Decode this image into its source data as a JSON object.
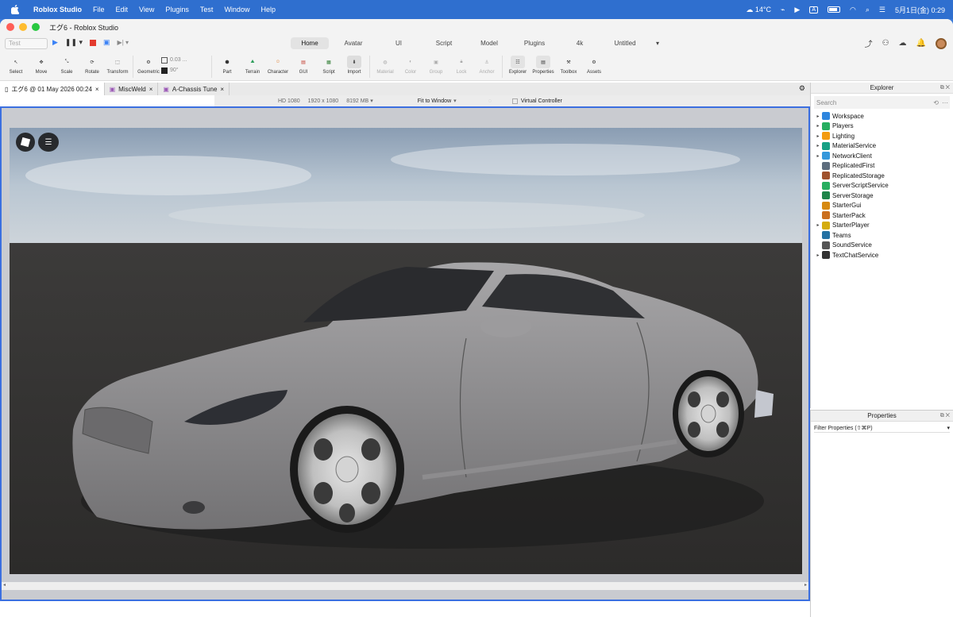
{
  "menubar": {
    "app_name": "Roblox Studio",
    "items": [
      "File",
      "Edit",
      "View",
      "Plugins",
      "Test",
      "Window",
      "Help"
    ],
    "weather": "14°C",
    "clock": "5月1日(金) 0:29",
    "input_indicator": "A"
  },
  "window": {
    "title": "エグ6 - Roblox Studio"
  },
  "tabsrow": {
    "test_placeholder": "Test",
    "ribbon_tabs": [
      "Home",
      "Avatar",
      "UI",
      "Script",
      "Model",
      "Plugins",
      "4k",
      "Untitled"
    ],
    "active_tab": "Home"
  },
  "toolbar": {
    "tools": [
      "Select",
      "Move",
      "Scale",
      "Rotate",
      "Transform",
      "Geometric"
    ],
    "snap_move": "0.03 ...",
    "snap_rotate": "90°",
    "insert_tools": [
      "Part",
      "Terrain",
      "Character",
      "GUI",
      "Script",
      "Import"
    ],
    "dim_tools": [
      "Material",
      "Color",
      "Group",
      "Lock",
      "Anchor"
    ],
    "panel_tools": [
      "Explorer",
      "Properties",
      "Toolbox",
      "Assets"
    ]
  },
  "doc_tabs": [
    {
      "label": "エグ6 @ 01 May 2026 00:24"
    },
    {
      "label": "MiscWeld"
    },
    {
      "label": "A-Chassis Tune"
    }
  ],
  "viewport_bar": {
    "device": "HD 1080",
    "resolution": "1920 x 1080",
    "memory": "8192 MB",
    "fit": "Fit to Window",
    "virtual_controller": "Virtual Controller"
  },
  "explorer": {
    "title": "Explorer",
    "search_placeholder": "Search",
    "items": [
      {
        "label": "Workspace",
        "expandable": true,
        "color": "#2e86de"
      },
      {
        "label": "Players",
        "expandable": true,
        "color": "#27ae60"
      },
      {
        "label": "Lighting",
        "expandable": true,
        "color": "#f39c12"
      },
      {
        "label": "MaterialService",
        "expandable": true,
        "color": "#16a085"
      },
      {
        "label": "NetworkClient",
        "expandable": true,
        "color": "#3498db"
      },
      {
        "label": "ReplicatedFirst",
        "expandable": false,
        "color": "#5d6d7e"
      },
      {
        "label": "ReplicatedStorage",
        "expandable": false,
        "color": "#a0522d"
      },
      {
        "label": "ServerScriptService",
        "expandable": false,
        "color": "#27ae60"
      },
      {
        "label": "ServerStorage",
        "expandable": false,
        "color": "#1e8449"
      },
      {
        "label": "StarterGui",
        "expandable": false,
        "color": "#d68910"
      },
      {
        "label": "StarterPack",
        "expandable": false,
        "color": "#ca6f1e"
      },
      {
        "label": "StarterPlayer",
        "expandable": true,
        "color": "#d4ac0d"
      },
      {
        "label": "Teams",
        "expandable": false,
        "color": "#2471a3"
      },
      {
        "label": "SoundService",
        "expandable": false,
        "color": "#555555"
      },
      {
        "label": "TextChatService",
        "expandable": true,
        "color": "#333333"
      }
    ]
  },
  "properties": {
    "title": "Properties",
    "filter_placeholder": "Filter Properties (⇧⌘P)"
  }
}
